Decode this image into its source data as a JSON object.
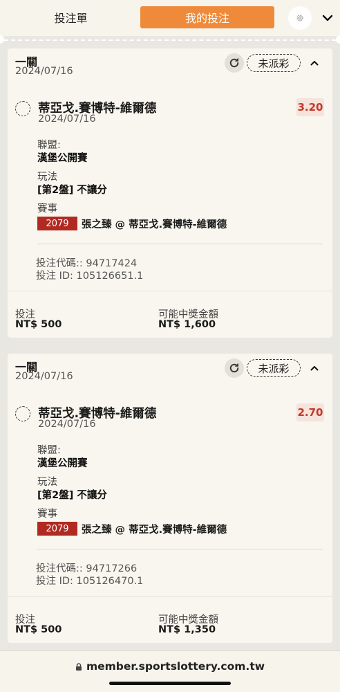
{
  "tabs": {
    "bet_slip": "投注單",
    "my_bets": "我的投注"
  },
  "icons": {
    "settings": "gear-icon",
    "top_chevron": "chevron-down-icon",
    "refresh": "refresh-icon",
    "collapse": "chevron-up-icon",
    "lock": "lock-icon"
  },
  "colors": {
    "accent": "#ee8a3a",
    "odds": "#c0392b",
    "event_code_bg": "#b02a22"
  },
  "bets": [
    {
      "type": "一關",
      "date": "2024/07/16",
      "status": "未派彩",
      "match": "蒂亞戈.賽博特-維爾德",
      "match_date": "2024/07/16",
      "odds": "3.20",
      "league_label": "聯盟:",
      "league": "漢堡公開賽",
      "play_label": "玩法",
      "play": "[第2盤] 不讓分",
      "event_label": "賽事",
      "event_code": "2079",
      "event": "張之臻 @ 蒂亞戈.賽博特-維爾德",
      "bet_code": "投注代碼:: 94717424",
      "bet_id": "投注 ID: 105126651.1",
      "stake_label": "投注",
      "stake": "NT$ 500",
      "win_label": "可能中獎金額",
      "win": "NT$ 1,600"
    },
    {
      "type": "一關",
      "date": "2024/07/16",
      "status": "未派彩",
      "match": "蒂亞戈.賽博特-維爾德",
      "match_date": "2024/07/16",
      "odds": "2.70",
      "league_label": "聯盟:",
      "league": "漢堡公開賽",
      "play_label": "玩法",
      "play": "[第2盤] 不讓分",
      "event_label": "賽事",
      "event_code": "2079",
      "event": "張之臻 @ 蒂亞戈.賽博特-維爾德",
      "bet_code": "投注代碼:: 94717266",
      "bet_id": "投注 ID: 105126470.1",
      "stake_label": "投注",
      "stake": "NT$ 500",
      "win_label": "可能中獎金額",
      "win": "NT$ 1,350"
    }
  ],
  "browser": {
    "url": "member.sportslottery.com.tw"
  }
}
